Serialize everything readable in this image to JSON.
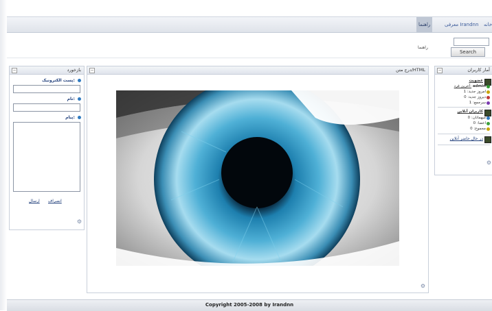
{
  "nav": {
    "items": [
      "خانه",
      "معرفی Irandnn",
      "راهنما"
    ],
    "active_label": "راهنما"
  },
  "search": {
    "button_label": "Search",
    "section_label": "راهنما"
  },
  "stats_panel": {
    "title": "آمار کاربران",
    "members_heading": "عضویت",
    "last_user_label": "آخرین فرد:",
    "last_user_value": "admin",
    "today_new": "امروز جدید: 1",
    "yesterday_new": "دیروز جدید: 0",
    "total": "سرجمع: 1",
    "online_heading": "کاربران آنلاین",
    "visitors": "میهمانان: 0",
    "members": "اعضا: 0",
    "sum": "مجموع: 0",
    "online_link": "در حال حاضر آنلاین"
  },
  "center_panel": {
    "title": "درج متن/HTML"
  },
  "contact_panel": {
    "title": "بازخورد",
    "email_label": "پست الکترونیک:",
    "subject_label": "نام:",
    "message_label": "پیام:",
    "send_label": "ارسال",
    "clear_label": "انصراف"
  },
  "footer": {
    "copyright": "Copyright 2005-2008 by Irandnn"
  },
  "colors": {
    "accent": "#3a5a9a",
    "panel_border": "#c8cfda"
  }
}
